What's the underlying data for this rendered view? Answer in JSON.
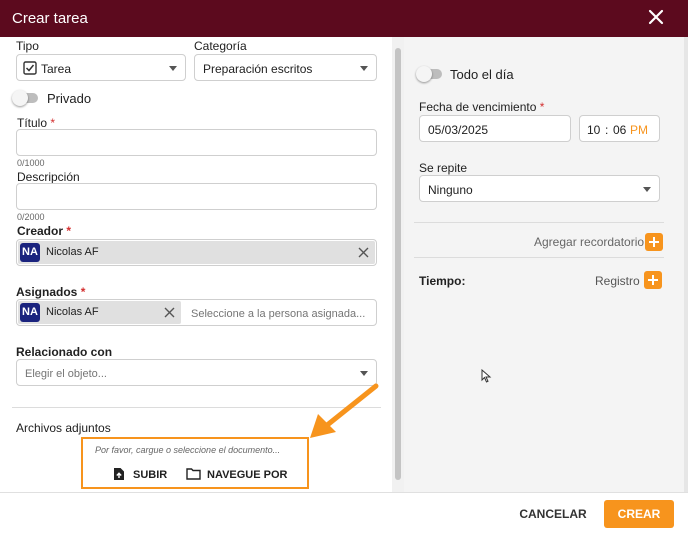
{
  "dialog": {
    "title": "Crear tarea"
  },
  "form": {
    "tipo": {
      "label": "Tipo",
      "value": "Tarea"
    },
    "categoria": {
      "label": "Categoría",
      "value": "Preparación escritos"
    },
    "privado": {
      "label": "Privado"
    },
    "titulo": {
      "label": "Título",
      "required": "*",
      "value": "",
      "counter": "0/1000"
    },
    "descripcion": {
      "label": "Descripción",
      "value": "",
      "counter": "0/2000"
    },
    "creador": {
      "label": "Creador",
      "required": "*",
      "chip": {
        "initials": "NA",
        "name": "Nicolas AF"
      }
    },
    "asignados": {
      "label": "Asignados",
      "required": "*",
      "chip": {
        "initials": "NA",
        "name": "Nicolas AF"
      },
      "placeholder": "Seleccione a la persona asignada..."
    },
    "relacionado": {
      "label": "Relacionado con",
      "placeholder": "Elegir el objeto..."
    },
    "archivos": {
      "label": "Archivos adjuntos",
      "hint": "Por favor, cargue o seleccione el documento...",
      "upload_label": "SUBIR",
      "browse_label": "NAVEGUE POR"
    }
  },
  "side": {
    "todo_el_dia": {
      "label": "Todo el día"
    },
    "fecha": {
      "label": "Fecha de vencimiento",
      "required": "*",
      "value": "05/03/2025"
    },
    "hora": {
      "hour": "10",
      "sep": ":",
      "minute": "06",
      "ampm": "PM"
    },
    "se_repite": {
      "label": "Se repite",
      "value": "Ninguno"
    },
    "recordatorio": {
      "label": "Agregar recordatorio"
    },
    "tiempo": {
      "label": "Tiempo:",
      "registro_label": "Registro"
    }
  },
  "footer": {
    "cancel_label": "CANCELAR",
    "create_label": "CREAR"
  },
  "colors": {
    "header": "#5c0a1e",
    "accent": "#f7941d",
    "avatar": "#1a237e",
    "required": "#d32f2f"
  },
  "icons": [
    "close-icon",
    "checkbox-checked-icon",
    "chevron-down-icon",
    "file-upload-icon",
    "folder-icon",
    "plus-icon",
    "clear-icon",
    "arrow-annotation-icon",
    "mouse-cursor-icon"
  ]
}
